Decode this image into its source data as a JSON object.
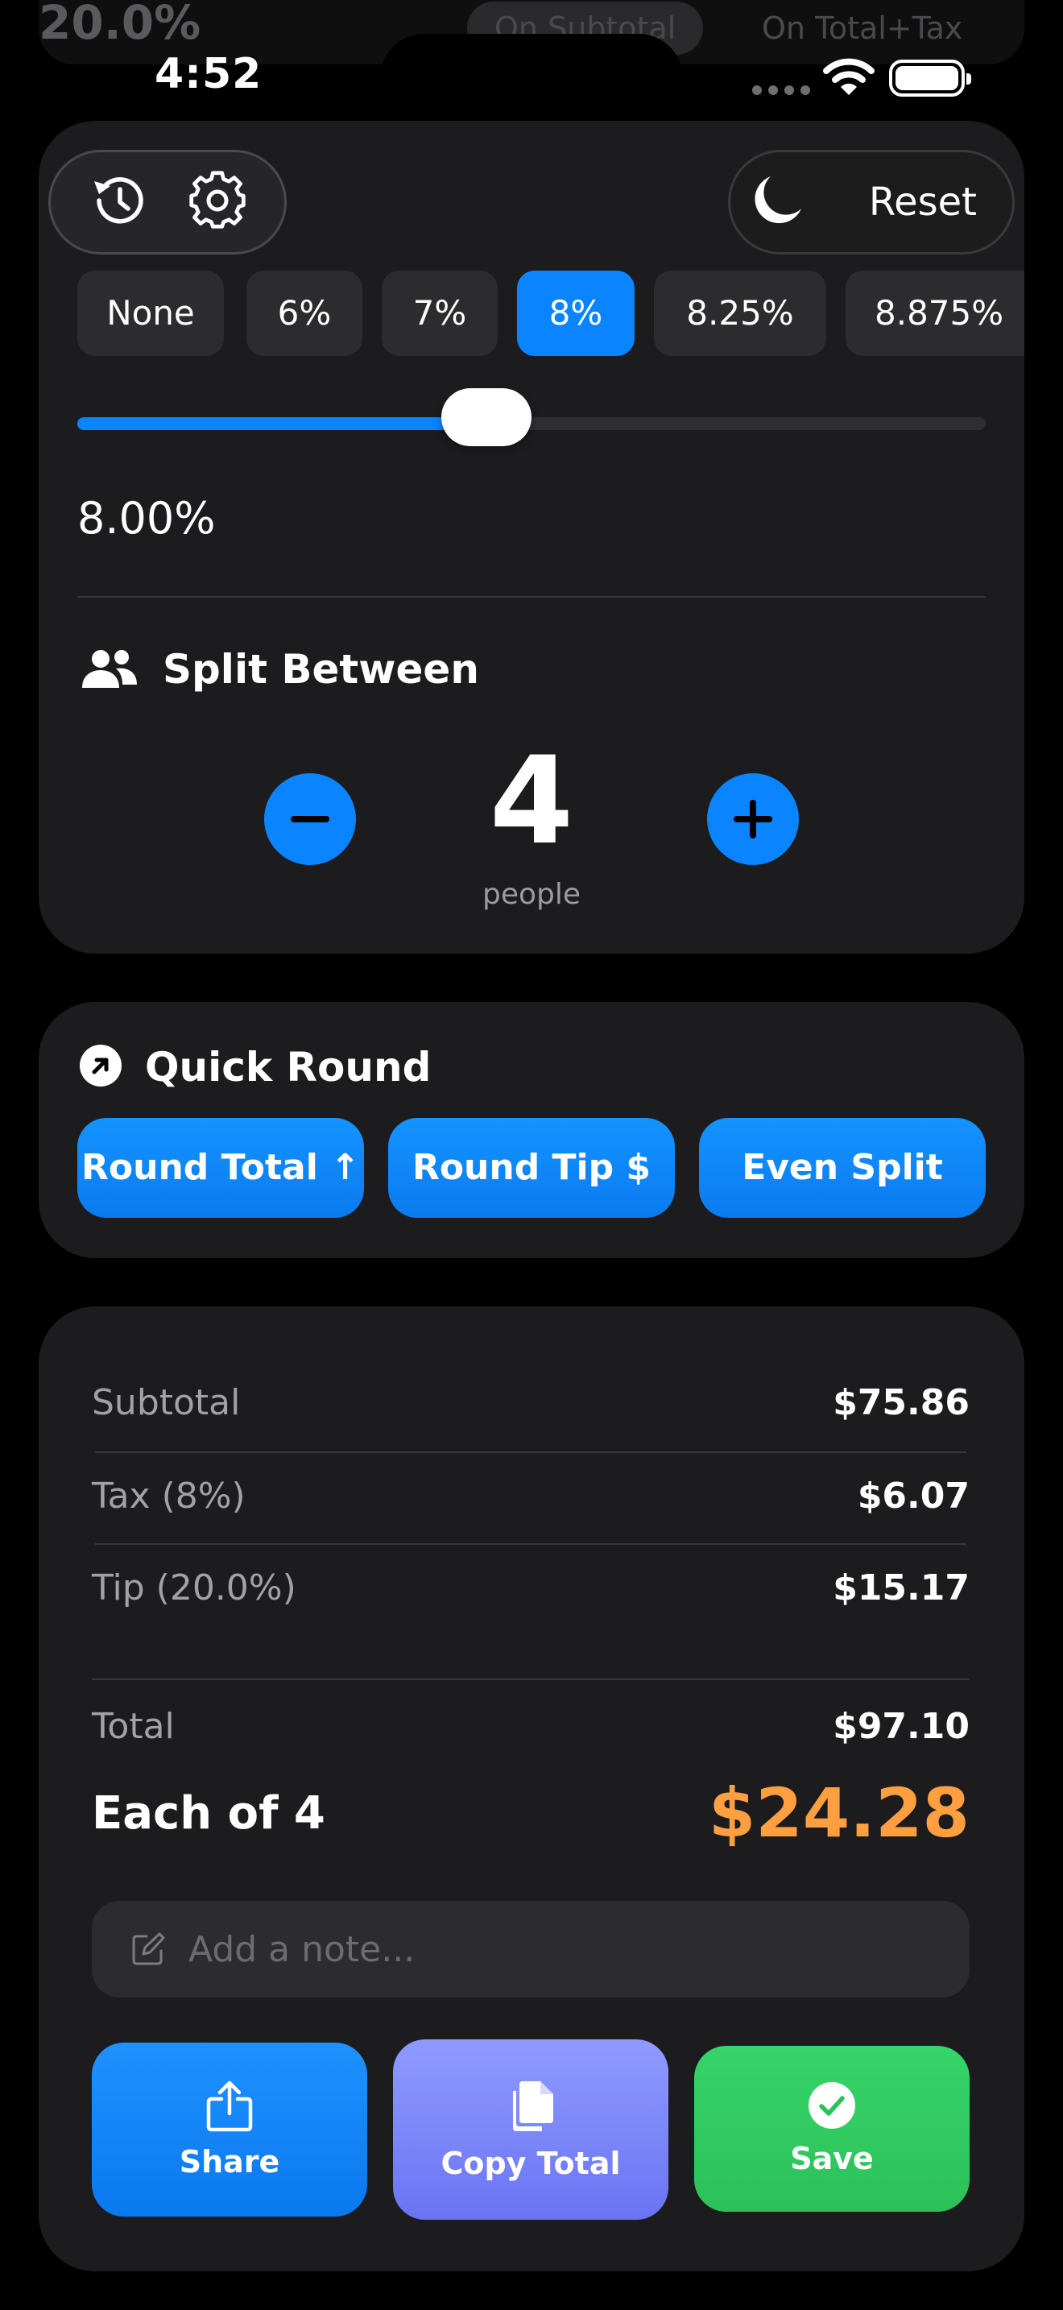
{
  "status_bar": {
    "time": "4:52"
  },
  "background_peek": {
    "tip_percent": "20.0%",
    "chip_subtotal": "On Subtotal",
    "chip_total_tax": "On Total+Tax"
  },
  "toolbar": {
    "history_icon": "history-icon",
    "settings_icon": "gear-icon",
    "theme_icon": "moon-icon",
    "reset_label": "Reset"
  },
  "tax": {
    "presets": [
      {
        "label": "None",
        "selected": false
      },
      {
        "label": "6%",
        "selected": false
      },
      {
        "label": "7%",
        "selected": false
      },
      {
        "label": "8%",
        "selected": true
      },
      {
        "label": "8.25%",
        "selected": false
      },
      {
        "label": "8.875%",
        "selected": false
      }
    ],
    "slider_fraction": 0.45,
    "value": "8.00%"
  },
  "split": {
    "title": "Split Between",
    "count": "4",
    "unit": "people"
  },
  "quick_round": {
    "title": "Quick Round",
    "buttons": [
      "Round Total ↑",
      "Round Tip $",
      "Even Split"
    ]
  },
  "summary": {
    "subtotal_label": "Subtotal",
    "subtotal_value": "$75.86",
    "tax_label": "Tax (8%)",
    "tax_value": "$6.07",
    "tip_label": "Tip (20.0%)",
    "tip_value": "$15.17",
    "total_label": "Total",
    "total_value": "$97.10",
    "each_label": "Each of 4",
    "each_value": "$24.28"
  },
  "note": {
    "placeholder": "Add a note...",
    "value": ""
  },
  "actions": {
    "share": "Share",
    "copy": "Copy Total",
    "save": "Save"
  },
  "colors": {
    "accent": "#0a84ff",
    "per_person": "#ff9f40",
    "save": "#30c75e",
    "copy": "#7a84f8"
  }
}
